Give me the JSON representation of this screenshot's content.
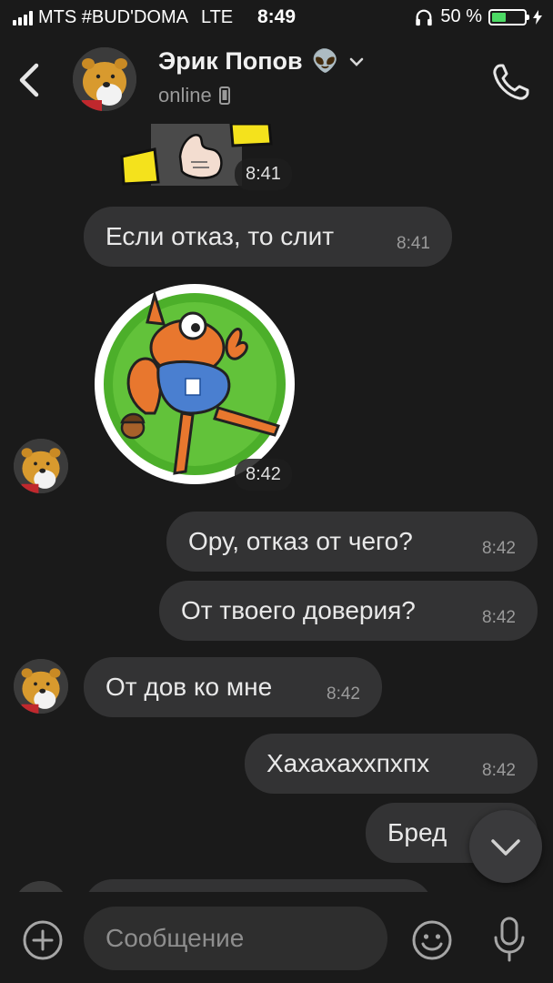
{
  "status_bar": {
    "carrier": "MTS #BUD'DOMA",
    "network": "LTE",
    "time": "8:49",
    "battery_percent": "50 %",
    "battery_level": 0.5,
    "icons": [
      "signal-icon",
      "headphones-icon",
      "battery-icon",
      "charging-icon"
    ]
  },
  "header": {
    "name": "Эрик Попов",
    "name_emoji": "👽",
    "status": "online",
    "icons": [
      "back-icon",
      "chevron-down-icon",
      "mobile-device-icon",
      "phone-icon"
    ]
  },
  "messages": [
    {
      "type": "sticker",
      "side": "in",
      "description_icon": "sticker-hand-tattoo",
      "time": "8:41"
    },
    {
      "type": "text",
      "side": "in",
      "text": "Если отказ, то слит",
      "time": "8:41"
    },
    {
      "type": "sticker",
      "side": "in",
      "description_icon": "sticker-squirrel-ok",
      "time": "8:42"
    },
    {
      "type": "text",
      "side": "out",
      "text": "Ору, отказ от чего?",
      "time": "8:42"
    },
    {
      "type": "text",
      "side": "out",
      "text": "От твоего доверия?",
      "time": "8:42"
    },
    {
      "type": "text",
      "side": "in",
      "text": "От дов ко мне",
      "time": "8:42"
    },
    {
      "type": "text",
      "side": "out",
      "text": "Хахахаххпхпх",
      "time": "8:42"
    },
    {
      "type": "text",
      "side": "out",
      "text": "Бред",
      "time": ""
    }
  ],
  "input": {
    "placeholder": "Сообщение",
    "icons": [
      "plus-icon",
      "emoji-icon",
      "microphone-icon"
    ]
  },
  "colors": {
    "background": "#1a1a1a",
    "bubble": "#333334",
    "timestamp": "#9b9b9b",
    "battery_fill": "#4cd964",
    "sticker_green": "#4caf2a",
    "squirrel_orange": "#e8772e",
    "hoodie_blue": "#4a7fd0"
  }
}
